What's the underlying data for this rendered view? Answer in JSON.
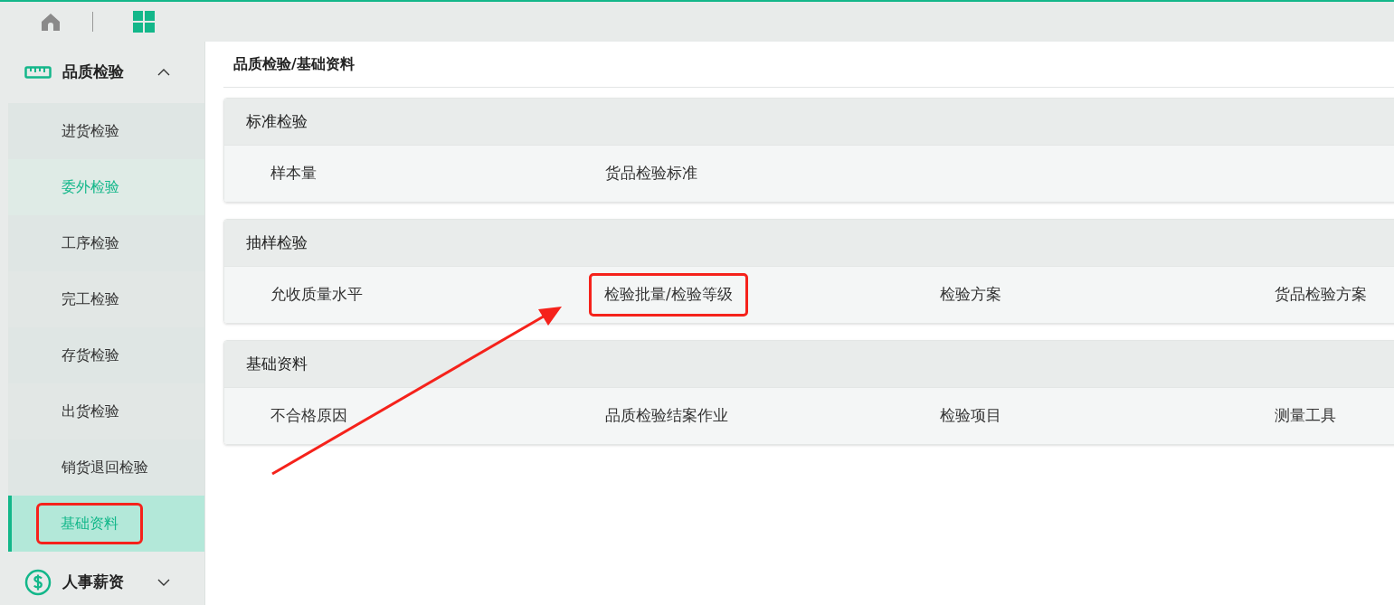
{
  "sidebar": {
    "groups": [
      {
        "title": "品质检验",
        "expanded": true,
        "items": [
          {
            "label": "进货检验",
            "selected": false,
            "hovered": false,
            "annotated": false
          },
          {
            "label": "委外检验",
            "selected": false,
            "hovered": true,
            "annotated": false
          },
          {
            "label": "工序检验",
            "selected": false,
            "hovered": false,
            "annotated": false
          },
          {
            "label": "完工检验",
            "selected": false,
            "hovered": false,
            "annotated": false
          },
          {
            "label": "存货检验",
            "selected": false,
            "hovered": false,
            "annotated": false
          },
          {
            "label": "出货检验",
            "selected": false,
            "hovered": false,
            "annotated": false
          },
          {
            "label": "销货退回检验",
            "selected": false,
            "hovered": false,
            "annotated": false
          },
          {
            "label": "基础资料",
            "selected": true,
            "hovered": false,
            "annotated": true
          }
        ]
      },
      {
        "title": "人事薪资",
        "expanded": false
      }
    ]
  },
  "breadcrumb": "品质检验/基础资料",
  "sections": [
    {
      "title": "标准检验",
      "links": [
        {
          "label": "样本量",
          "annotated": false
        },
        {
          "label": "货品检验标准",
          "annotated": false
        }
      ]
    },
    {
      "title": "抽样检验",
      "links": [
        {
          "label": "允收质量水平",
          "annotated": false
        },
        {
          "label": "检验批量/检验等级",
          "annotated": true
        },
        {
          "label": "检验方案",
          "annotated": false
        },
        {
          "label": "货品检验方案",
          "annotated": false
        }
      ]
    },
    {
      "title": "基础资料",
      "links": [
        {
          "label": "不合格原因",
          "annotated": false
        },
        {
          "label": "品质检验结案作业",
          "annotated": false
        },
        {
          "label": "检验项目",
          "annotated": false
        },
        {
          "label": "测量工具",
          "annotated": false
        }
      ]
    }
  ]
}
